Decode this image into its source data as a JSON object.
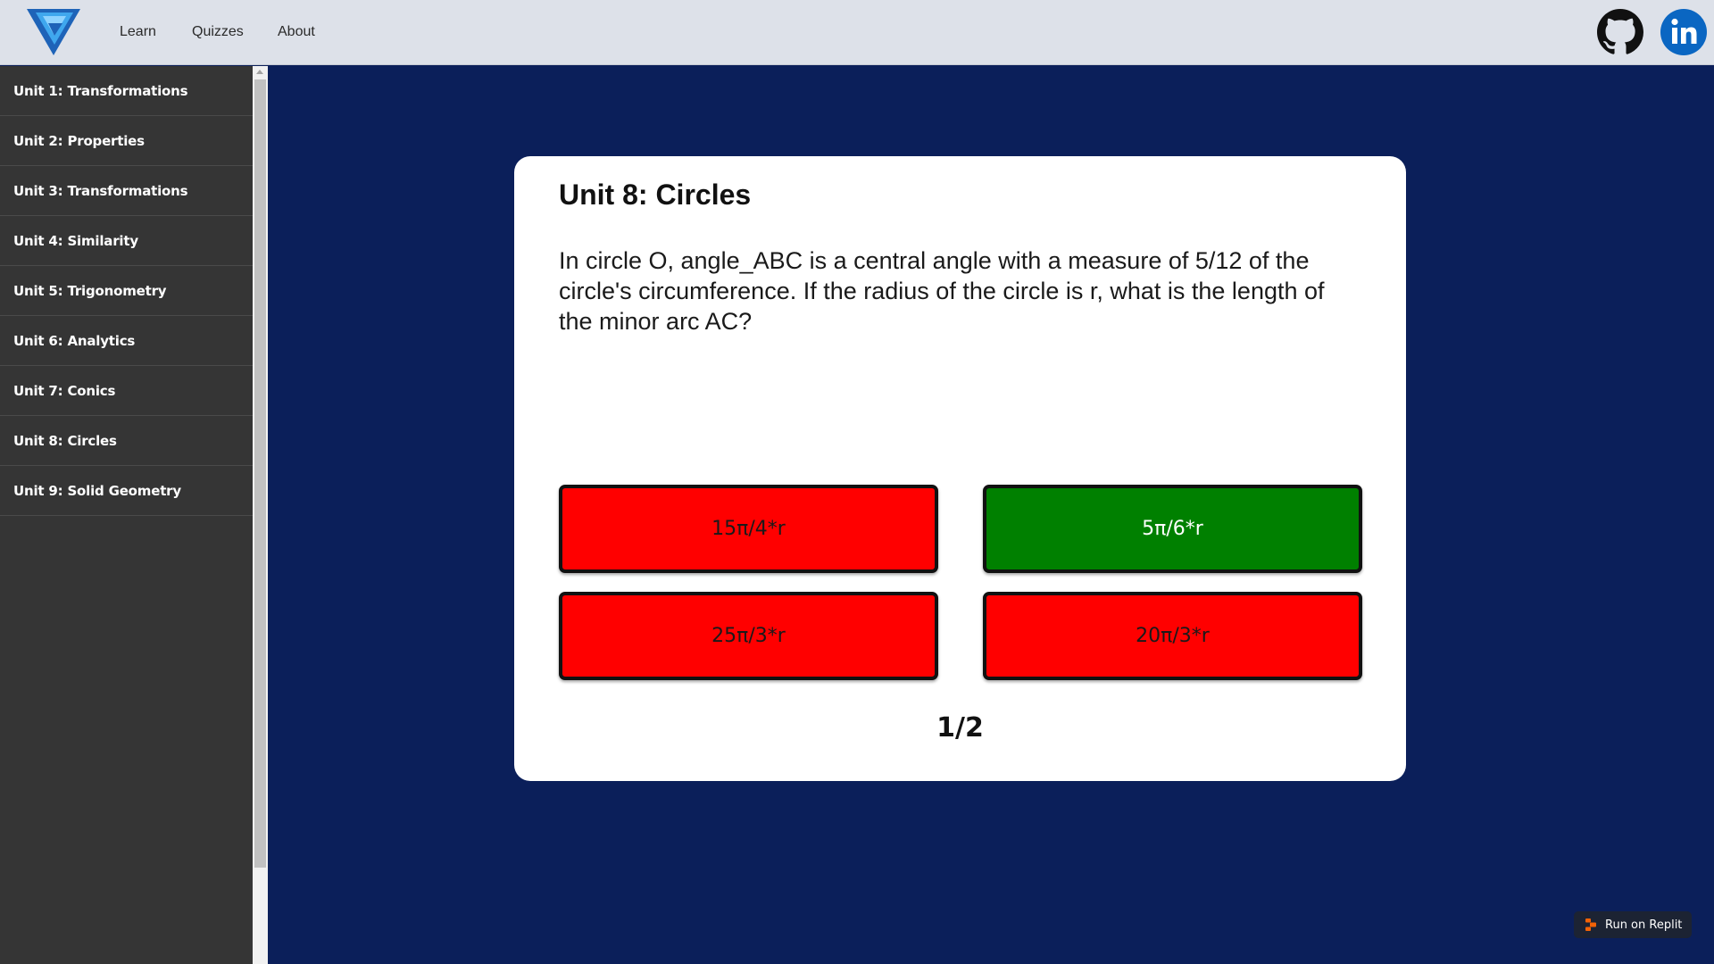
{
  "nav": {
    "links": [
      "Learn",
      "Quizzes",
      "About"
    ]
  },
  "sidebar": {
    "items": [
      {
        "label": "Unit 1: Transformations"
      },
      {
        "label": "Unit 2: Properties"
      },
      {
        "label": "Unit 3: Transformations"
      },
      {
        "label": "Unit 4: Similarity"
      },
      {
        "label": "Unit 5: Trigonometry"
      },
      {
        "label": "Unit 6: Analytics"
      },
      {
        "label": "Unit 7: Conics"
      },
      {
        "label": "Unit 8: Circles"
      },
      {
        "label": "Unit 9: Solid Geometry"
      }
    ]
  },
  "quiz": {
    "title": "Unit 8: Circles",
    "question": "In circle O, angle_ABC is a central angle with a measure of 5/12 of the circle's circumference. If the radius of the circle is r, what is the length of the minor arc AC?",
    "answers": [
      {
        "label": "15π/4*r",
        "status": "incorrect",
        "color": "#ff0000"
      },
      {
        "label": "5π/6*r",
        "status": "correct",
        "color": "#008000"
      },
      {
        "label": "25π/3*r",
        "status": "incorrect",
        "color": "#ff0000"
      },
      {
        "label": "20π/3*r",
        "status": "incorrect",
        "color": "#ff0000"
      }
    ],
    "progress": "1/2"
  },
  "replit": {
    "label": "Run on Replit"
  },
  "icons": {
    "logo": "triangle-logo-icon",
    "github": "github-icon",
    "linkedin": "linkedin-icon",
    "replit": "replit-icon"
  },
  "colors": {
    "background": "#0b1f5a",
    "sidebar": "#353535",
    "topbar": "#dde1e9",
    "linkedin": "#0a66c2"
  }
}
